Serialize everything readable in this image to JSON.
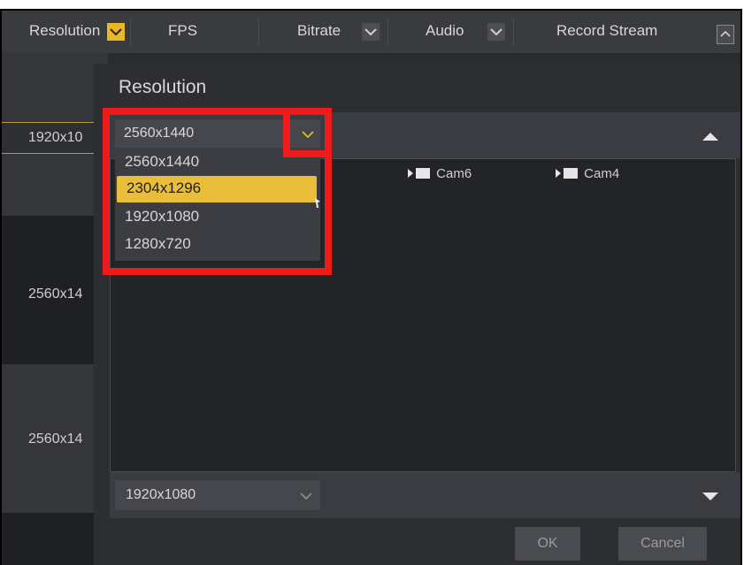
{
  "header": {
    "columns": [
      "Resolution",
      "FPS",
      "Bitrate",
      "Audio",
      "Record Stream"
    ]
  },
  "left_column": {
    "rows": [
      "1920x10",
      "2560x14",
      "2560x14"
    ]
  },
  "modal": {
    "title": "Resolution",
    "top_combo_value": "2560x1440",
    "dropdown_options": [
      "2560x1440",
      "2304x1296",
      "1920x1080",
      "1280x720"
    ],
    "highlighted_option": "2304x1296",
    "cameras": [
      "Cam6",
      "Cam4"
    ],
    "bottom_combo_value": "1920x1080",
    "ok_label": "OK",
    "cancel_label": "Cancel"
  },
  "colors": {
    "highlight": "#e9be3b",
    "annotation_red": "#ef1a1a",
    "background": "#2a2b2f"
  },
  "icons": [
    "chevron-down-icon",
    "chevron-up-icon",
    "camera-icon",
    "triangle-up-icon",
    "triangle-down-icon"
  ]
}
